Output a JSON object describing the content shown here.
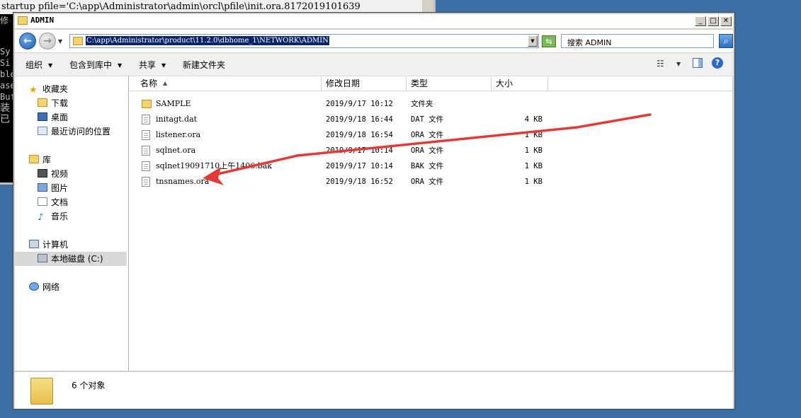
{
  "console": {
    "command": "startup pfile='C:\\app\\Administrator\\admin\\orcl\\pfile\\init.ora.8172019101639",
    "fragments": [
      "修",
      "Sy",
      "Si",
      "ble",
      "ase",
      "Buf",
      "装",
      "已"
    ]
  },
  "window": {
    "title": "ADMIN",
    "address_path": "C:\\app\\Administrator\\product\\11.2.0\\dbhome_1\\NETWORK\\ADMIN",
    "search_placeholder": "搜索 ADMIN",
    "min_glyph": "_",
    "max_glyph": "□",
    "close_glyph": "✕"
  },
  "toolbar": {
    "organize": "组织",
    "include_in_library": "包含到库中",
    "share": "共享",
    "new_folder": "新建文件夹"
  },
  "nav": {
    "favorites": "收藏夹",
    "downloads": "下载",
    "desktop": "桌面",
    "recent": "最近访问的位置",
    "libraries": "库",
    "videos": "视频",
    "pictures": "图片",
    "documents": "文档",
    "music": "音乐",
    "computer": "计算机",
    "local_disk": "本地磁盘 (C:)",
    "network": "网络"
  },
  "columns": {
    "name": "名称",
    "modified": "修改日期",
    "type": "类型",
    "size": "大小"
  },
  "files": [
    {
      "name": "SAMPLE",
      "modified": "2019/9/17 10:12",
      "type": "文件夹",
      "size": "",
      "icon": "folder-icon"
    },
    {
      "name": "initagt.dat",
      "modified": "2019/9/18 16:44",
      "type": "DAT 文件",
      "size": "4 KB",
      "icon": "file-icon"
    },
    {
      "name": "listener.ora",
      "modified": "2019/9/18 16:54",
      "type": "ORA 文件",
      "size": "1 KB",
      "icon": "file-icon"
    },
    {
      "name": "sqlnet.ora",
      "modified": "2019/9/17 10:14",
      "type": "ORA 文件",
      "size": "1 KB",
      "icon": "file-icon"
    },
    {
      "name": "sqlnet19091710上午1406.bak",
      "modified": "2019/9/17 10:14",
      "type": "BAK 文件",
      "size": "1 KB",
      "icon": "file-icon"
    },
    {
      "name": "tnsnames.ora",
      "modified": "2019/9/18 16:52",
      "type": "ORA 文件",
      "size": "1 KB",
      "icon": "file-icon"
    }
  ],
  "status": {
    "count_text": "6 个对象"
  },
  "annotation": {
    "arrow_color": "#e53935"
  }
}
